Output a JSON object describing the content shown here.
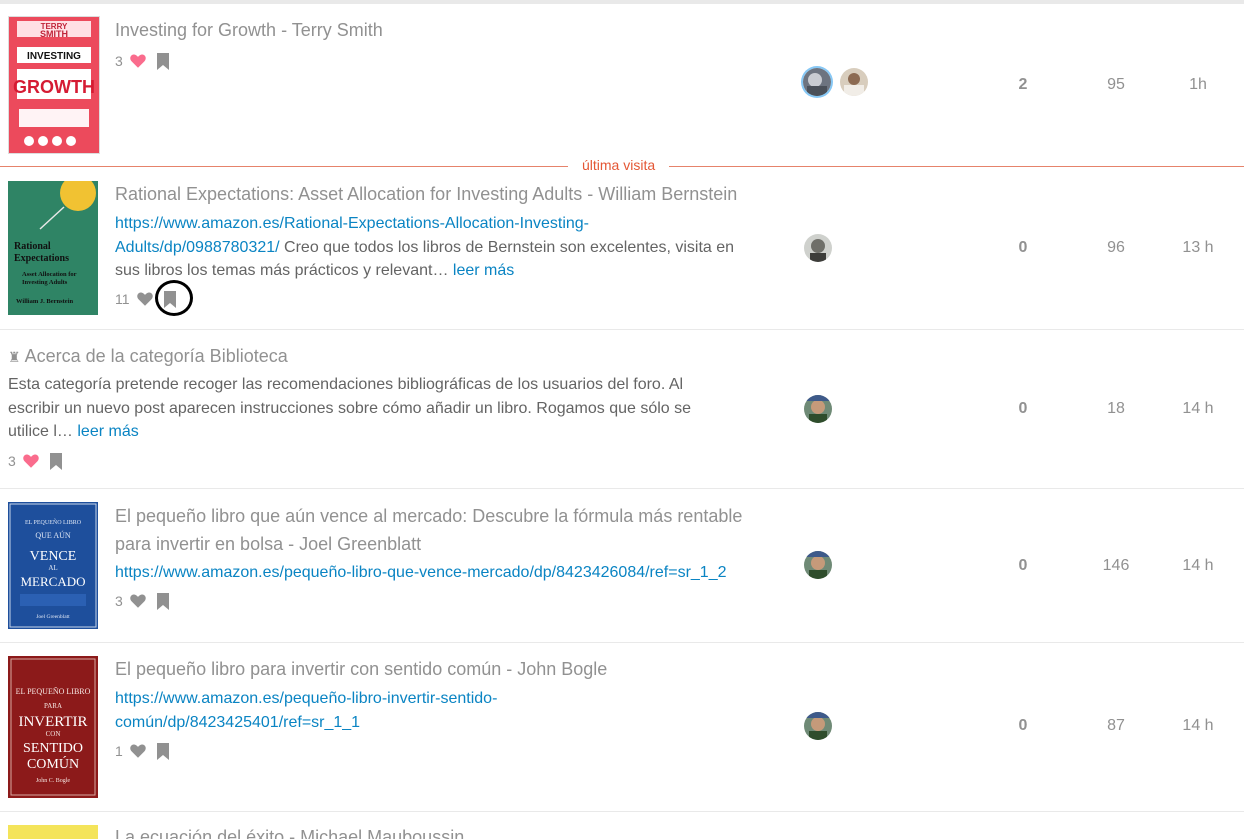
{
  "last_visit_label": "última visita",
  "topics": [
    {
      "title": "Investing for Growth - Terry Smith",
      "likes": "3",
      "liked": true,
      "replies": "2",
      "views": "95",
      "activity": "1h",
      "cover": {
        "color": "#e8384f",
        "lines": [
          "TERRY",
          "SMITH",
          "INVESTING",
          "GROWTH"
        ]
      }
    },
    {
      "title": "Rational Expectations: Asset Allocation for Investing Adults - William Bernstein",
      "link_text_1": "https://www.amazon.es/Rational-Expectations-Allocation-Investing-",
      "link_text_2": "Adults/dp/0988780321/",
      "excerpt_1": " Creo que todos los libros de Bernstein son excelentes, visita en",
      "excerpt_2": "sus libros los temas más prácticos y relevant…",
      "read_more": "leer más",
      "likes": "11",
      "liked": false,
      "replies": "0",
      "views": "96",
      "activity": "13 h",
      "cover": {
        "color": "#2a7a5e",
        "lines": [
          "Rational",
          "Expectations",
          "Asset Allocation for",
          "Investing Adults",
          "William J. Bernstein"
        ]
      }
    },
    {
      "title": "Acerca de la categoría Biblioteca",
      "excerpt_1": "Esta categoría pretende recoger las recomendaciones bibliográficas de los usuarios del foro. Al",
      "excerpt_2": "escribir un nuevo post aparecen instrucciones sobre cómo añadir un libro. Rogamos que sólo se",
      "excerpt_3": "utilice l…",
      "read_more": "leer más",
      "likes": "3",
      "liked": true,
      "replies": "0",
      "views": "18",
      "activity": "14 h"
    },
    {
      "title_1": "El pequeño libro que aún vence al mercado: Descubre la fórmula más rentable",
      "title_2": "para invertir en bolsa - Joel Greenblatt",
      "link_text_1": "https://www.amazon.es/pequeño-libro-que-vence-mercado/dp/8423426084/ref=sr_1_2",
      "likes": "3",
      "liked": false,
      "replies": "0",
      "views": "146",
      "activity": "14 h",
      "cover": {
        "color": "#1f4a8f",
        "lines": [
          "EL PEQUEÑO LIBRO",
          "QUE AÚN",
          "VENCE",
          "AL",
          "MERCADO",
          "Joel Greenblatt"
        ]
      }
    },
    {
      "title": "El pequeño libro para invertir con sentido común - John Bogle",
      "link_text_1": "https://www.amazon.es/pequeño-libro-invertir-sentido-",
      "link_text_2": "común/dp/8423425401/ref=sr_1_1",
      "likes": "1",
      "liked": false,
      "replies": "0",
      "views": "87",
      "activity": "14 h",
      "cover": {
        "color": "#8e1b1b",
        "lines": [
          "EL PEQUEÑO LIBRO",
          "PARA",
          "INVERTIR",
          "CON",
          "SENTIDO",
          "COMÚN",
          "John C. Bogle"
        ]
      }
    },
    {
      "title": "La ecuación del éxito - Michael Mauboussin"
    }
  ]
}
